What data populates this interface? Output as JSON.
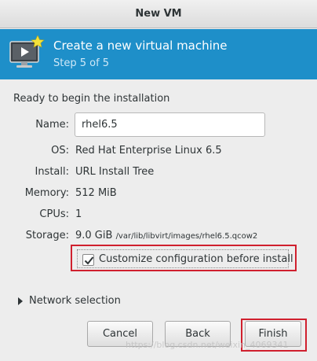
{
  "window": {
    "title": "New VM"
  },
  "header": {
    "title": "Create a new virtual machine",
    "step": "Step 5 of 5",
    "icon": "monitor-play-icon"
  },
  "summary": {
    "heading": "Ready to begin the installation",
    "name_label": "Name:",
    "name_value": "rhel6.5",
    "os_label": "OS:",
    "os_value": "Red Hat Enterprise Linux 6.5",
    "install_label": "Install:",
    "install_value": "URL Install Tree",
    "memory_label": "Memory:",
    "memory_value": "512 MiB",
    "cpus_label": "CPUs:",
    "cpus_value": "1",
    "storage_label": "Storage:",
    "storage_size": "9.0 GiB",
    "storage_path": "/var/lib/libvirt/images/rhel6.5.qcow2"
  },
  "customize": {
    "label": "Customize configuration before install",
    "checked": true
  },
  "network": {
    "label": "Network selection"
  },
  "buttons": {
    "cancel": "Cancel",
    "back": "Back",
    "finish": "Finish"
  },
  "watermark": "https://blog.csdn.net/weixin_4069341",
  "colors": {
    "header_bg": "#1e8fc9",
    "highlight": "#d0202e"
  }
}
